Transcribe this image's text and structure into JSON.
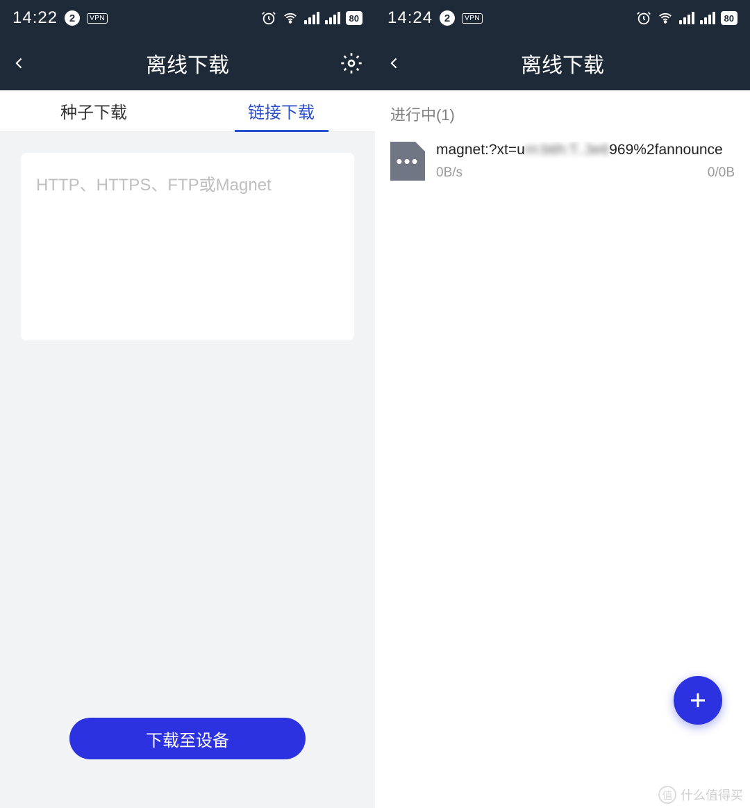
{
  "left": {
    "status": {
      "time": "14:22",
      "badge": "2",
      "vpn": "VPN",
      "battery": "80"
    },
    "nav": {
      "title": "离线下载"
    },
    "tabs": {
      "seed": "种子下载",
      "link": "链接下载"
    },
    "input": {
      "placeholder": "HTTP、HTTPS、FTP或Magnet"
    },
    "button": {
      "label": "下载至设备"
    }
  },
  "right": {
    "status": {
      "time": "14:24",
      "badge": "2",
      "vpn": "VPN",
      "battery": "80"
    },
    "nav": {
      "title": "离线下载"
    },
    "section": {
      "title": "进行中(1)"
    },
    "item": {
      "title_pre": "magnet:?xt=u",
      "title_blur": "rn:btih:T..3e6",
      "title_post": "969%2fannounce",
      "speed": "0B/s",
      "progress": "0/0B"
    }
  },
  "watermark": {
    "text": "什么值得买",
    "symbol": "值"
  }
}
